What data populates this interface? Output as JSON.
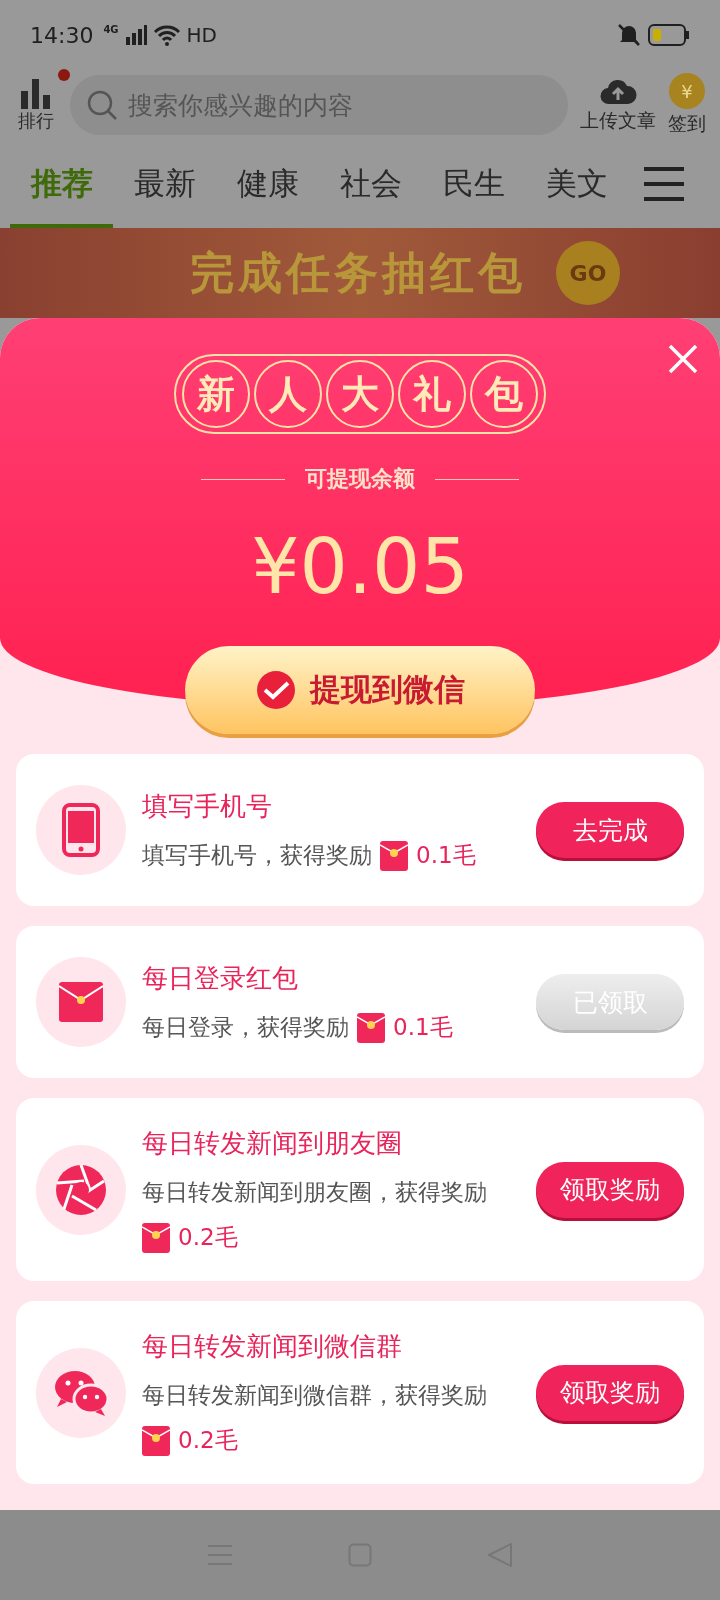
{
  "status_bar": {
    "time": "14:30",
    "network": "4G",
    "hd": "HD"
  },
  "header": {
    "ranking_label": "排行",
    "ranking_badge": true,
    "search": {
      "placeholder": "搜索你感兴趣的内容"
    },
    "upload_label": "上传文章",
    "checkin_icon": "¥",
    "checkin_label": "签到"
  },
  "tabs": [
    {
      "label": "推荐",
      "selected": true
    },
    {
      "label": "最新",
      "selected": false
    },
    {
      "label": "健康",
      "selected": false
    },
    {
      "label": "社会",
      "selected": false
    },
    {
      "label": "民生",
      "selected": false
    },
    {
      "label": "美文",
      "selected": false
    }
  ],
  "banner": {
    "title": "完成任务抽红包",
    "go": "GO"
  },
  "popup": {
    "title_chars": [
      "新",
      "人",
      "大",
      "礼",
      "包"
    ],
    "subtitle": "可提现余额",
    "amount": "¥0.05",
    "withdraw_button": "提现到微信",
    "tasks": [
      {
        "kind": "phone",
        "title": "填写手机号",
        "description": "填写手机号，获得奖励",
        "reward": "0.1毛",
        "button": "去完成",
        "claimed": false
      },
      {
        "kind": "envelope",
        "title": "每日登录红包",
        "description": "每日登录，获得奖励",
        "reward": "0.1毛",
        "button": "已领取",
        "claimed": true
      },
      {
        "kind": "aperture",
        "title": "每日转发新闻到朋友圈",
        "description": "每日转发新闻到朋友圈，获得奖励",
        "reward": "0.2毛",
        "button": "领取奖励",
        "claimed": false
      },
      {
        "kind": "chat",
        "title": "每日转发新闻到微信群",
        "description": "每日转发新闻到微信群，获得奖励",
        "reward": "0.2毛",
        "button": "领取奖励",
        "claimed": false
      }
    ]
  }
}
